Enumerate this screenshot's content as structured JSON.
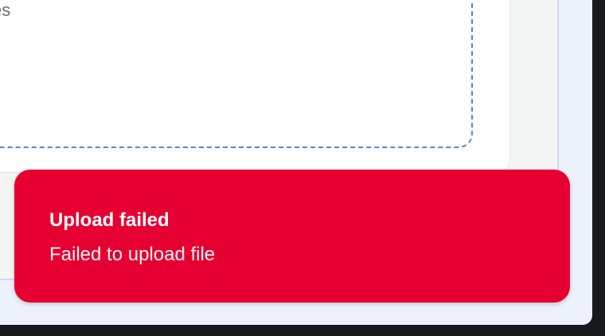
{
  "drop_zone": {
    "hint_fragment": "es"
  },
  "toast": {
    "title": "Upload failed",
    "message": "Failed to upload file",
    "status": "error",
    "color": "#e60032"
  },
  "colors": {
    "drop_zone_border": "#4a8ae0",
    "window_background": "#edf1fb"
  }
}
